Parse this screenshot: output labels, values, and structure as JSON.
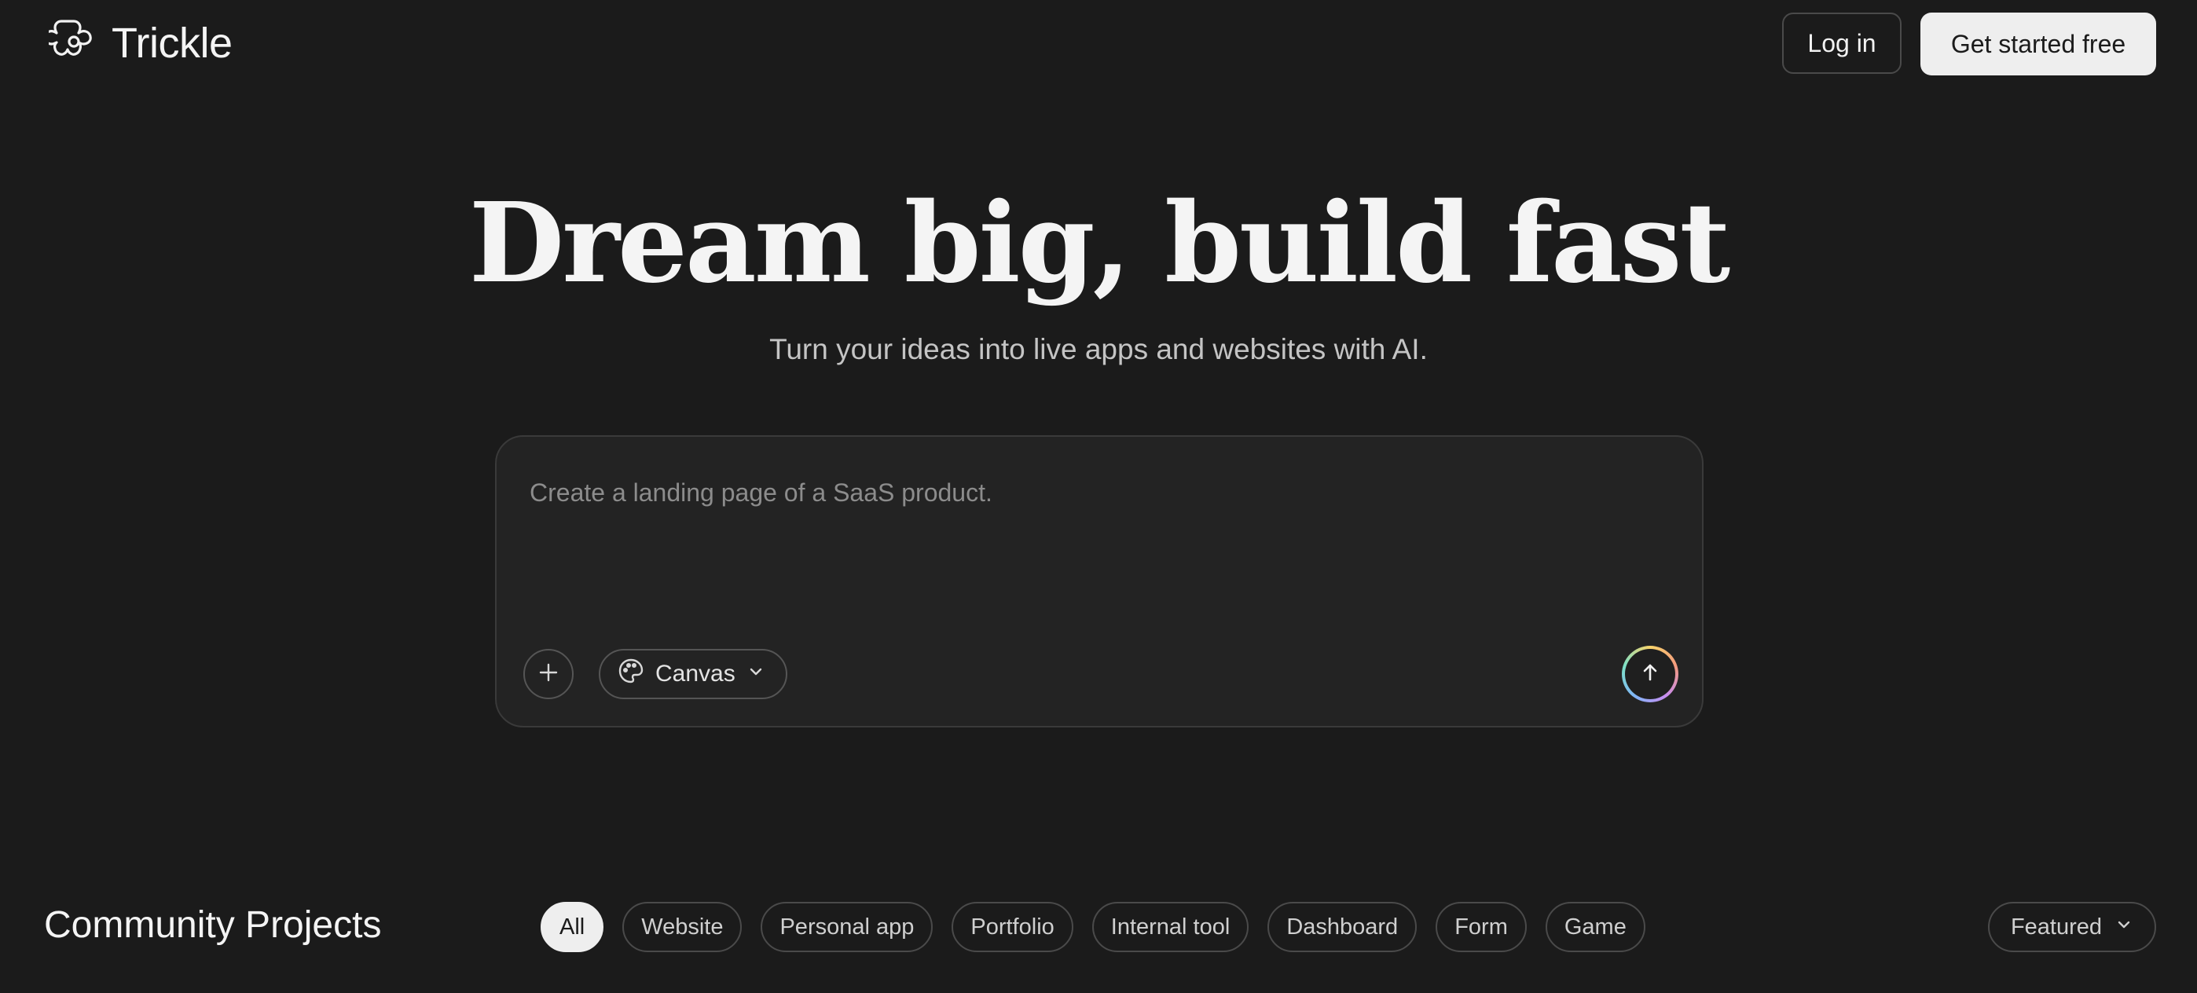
{
  "header": {
    "logo_icon": "trickle-flower-icon",
    "brand": "Trickle",
    "login_label": "Log in",
    "cta_label": "Get started free"
  },
  "hero": {
    "title": "Dream big, build fast",
    "subtitle": "Turn your ideas into live apps and websites with AI."
  },
  "prompt": {
    "placeholder": "Create a landing page of a SaaS product.",
    "value": "",
    "add_icon": "plus-icon",
    "mode_icon": "palette-icon",
    "mode_label": "Canvas",
    "send_icon": "arrow-up-icon"
  },
  "community": {
    "title": "Community Projects",
    "filters": [
      {
        "label": "All",
        "active": true
      },
      {
        "label": "Website",
        "active": false
      },
      {
        "label": "Personal app",
        "active": false
      },
      {
        "label": "Portfolio",
        "active": false
      },
      {
        "label": "Internal tool",
        "active": false
      },
      {
        "label": "Dashboard",
        "active": false
      },
      {
        "label": "Form",
        "active": false
      },
      {
        "label": "Game",
        "active": false
      }
    ],
    "sort_label": "Featured"
  },
  "colors": {
    "background": "#1b1b1b",
    "primary_button": "#eeeeee",
    "text": "#f2f2f2",
    "muted_text": "#8c8c8c"
  }
}
